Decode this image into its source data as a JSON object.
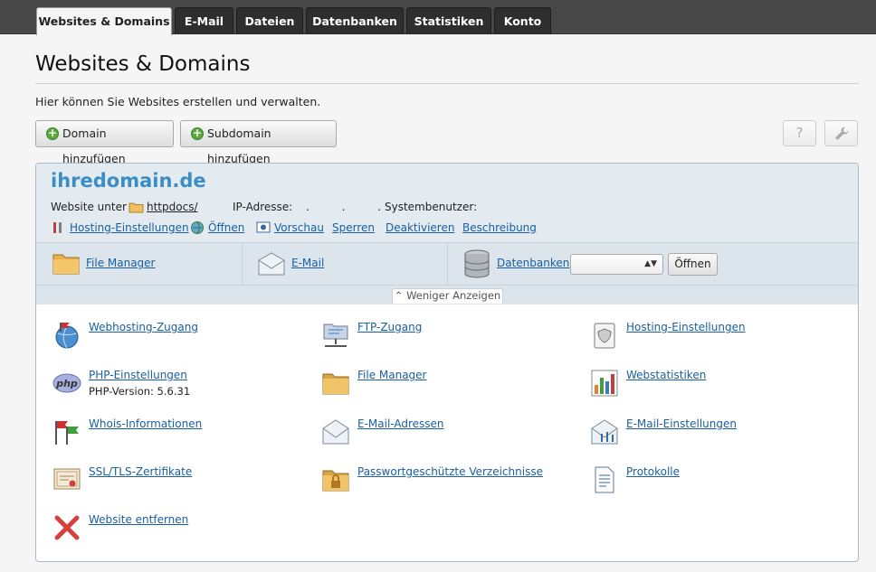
{
  "tabs": [
    {
      "label": "Websites & Domains",
      "active": true
    },
    {
      "label": "E-Mail"
    },
    {
      "label": "Dateien"
    },
    {
      "label": "Datenbanken"
    },
    {
      "label": "Statistiken"
    },
    {
      "label": "Konto"
    }
  ],
  "page": {
    "title": "Websites & Domains",
    "intro": "Hier können Sie Websites erstellen und verwalten."
  },
  "toolbar": {
    "add_domain": "Domain hinzufügen",
    "add_subdomain": "Subdomain hinzufügen",
    "help_icon_label": "?"
  },
  "domain": {
    "name": "ihredomain.de",
    "website_under_label": "Website unter",
    "docroot": "httpdocs/",
    "ip_label": "IP-Adresse:",
    "ip_value": ". . .",
    "sysuser_label": "Systembenutzer:",
    "actions": [
      "Hosting-Einstellungen",
      "Öffnen",
      "Vorschau",
      "Sperren",
      "Deaktivieren",
      "Beschreibung"
    ]
  },
  "quick": {
    "file_manager": "File Manager",
    "email": "E-Mail",
    "databases": "Datenbanken",
    "open_button": "Öffnen"
  },
  "toggle_label": "Weniger Anzeigen",
  "items": {
    "webhosting": "Webhosting-Zugang",
    "ftp": "FTP-Zugang",
    "hosting_settings": "Hosting-Einstellungen",
    "php": "PHP-Einstellungen",
    "php_version": "PHP-Version: 5.6.31",
    "file_manager": "File Manager",
    "webstats": "Webstatistiken",
    "whois": "Whois-Informationen",
    "email_addresses": "E-Mail-Adressen",
    "email_settings": "E-Mail-Einstellungen",
    "ssl": "SSL/TLS-Zertifikate",
    "protected_dirs": "Passwortgeschützte Verzeichnisse",
    "logs": "Protokolle",
    "remove_site": "Website entfernen"
  }
}
